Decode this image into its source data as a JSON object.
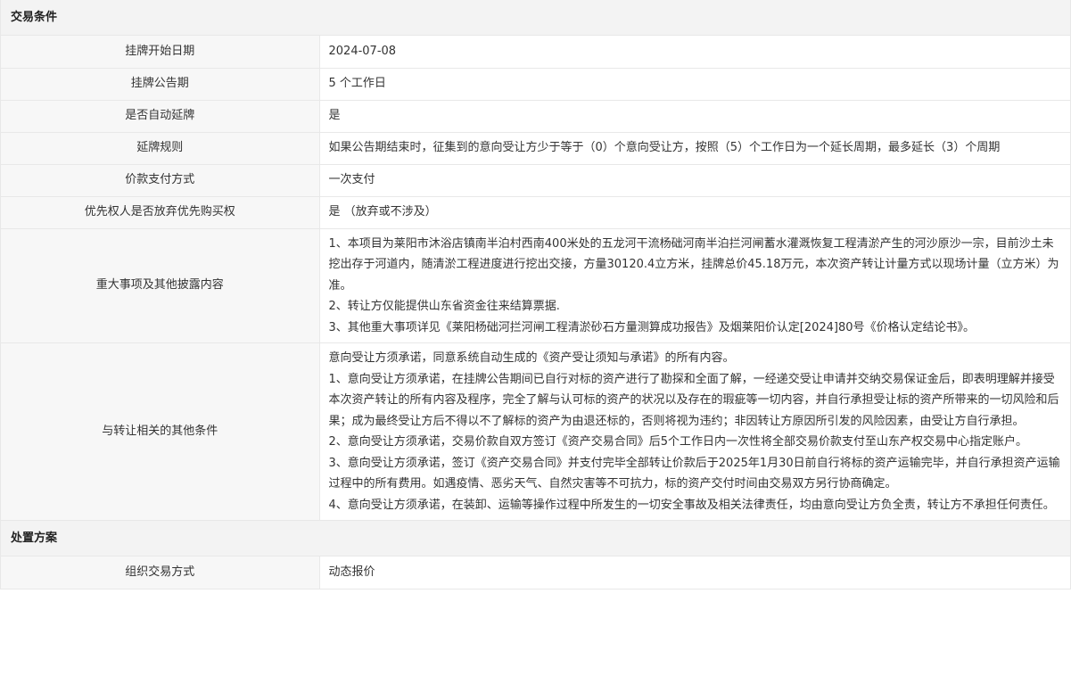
{
  "sections": [
    {
      "title": "交易条件",
      "rows": [
        {
          "label": "挂牌开始日期",
          "value": [
            "2024-07-08"
          ]
        },
        {
          "label": "挂牌公告期",
          "value": [
            "5 个工作日"
          ]
        },
        {
          "label": "是否自动延牌",
          "value": [
            "是"
          ]
        },
        {
          "label": "延牌规则",
          "value": [
            "如果公告期结束时，征集到的意向受让方少于等于（0）个意向受让方，按照（5）个工作日为一个延长周期，最多延长（3）个周期"
          ]
        },
        {
          "label": "价款支付方式",
          "value": [
            "一次支付"
          ]
        },
        {
          "label": "优先权人是否放弃优先购买权",
          "value": [
            "是 （放弃或不涉及）"
          ]
        },
        {
          "label": "重大事项及其他披露内容",
          "value": [
            "1、本项目为莱阳市沐浴店镇南半泊村西南400米处的五龙河干流杨础河南半泊拦河闸蓄水灌溉恢复工程清淤产生的河沙原沙一宗，目前沙土未挖出存于河道内，随清淤工程进度进行挖出交接，方量30120.4立方米，挂牌总价45.18万元，本次资产转让计量方式以现场计量（立方米）为准。",
            "2、转让方仅能提供山东省资金往来结算票据.",
            "3、其他重大事项详见《莱阳杨础河拦河闸工程清淤砂石方量测算成功报告》及烟莱阳价认定[2024]80号《价格认定结论书》。"
          ]
        },
        {
          "label": "与转让相关的其他条件",
          "value": [
            "意向受让方须承诺，同意系统自动生成的《资产受让须知与承诺》的所有内容。",
            "1、意向受让方须承诺，在挂牌公告期间已自行对标的资产进行了勘探和全面了解，一经递交受让申请并交纳交易保证金后，即表明理解并接受本次资产转让的所有内容及程序，完全了解与认可标的资产的状况以及存在的瑕疵等一切内容，并自行承担受让标的资产所带来的一切风险和后果；成为最终受让方后不得以不了解标的资产为由退还标的，否则将视为违约；非因转让方原因所引发的风险因素，由受让方自行承担。",
            "2、意向受让方须承诺，交易价款自双方签订《资产交易合同》后5个工作日内一次性将全部交易价款支付至山东产权交易中心指定账户。",
            "3、意向受让方须承诺，签订《资产交易合同》并支付完毕全部转让价款后于2025年1月30日前自行将标的资产运输完毕，并自行承担资产运输过程中的所有费用。如遇疫情、恶劣天气、自然灾害等不可抗力，标的资产交付时间由交易双方另行协商确定。",
            "4、意向受让方须承诺，在装卸、运输等操作过程中所发生的一切安全事故及相关法律责任，均由意向受让方负全责，转让方不承担任何责任。"
          ]
        }
      ]
    },
    {
      "title": "处置方案",
      "rows": [
        {
          "label": "组织交易方式",
          "value": [
            "动态报价"
          ]
        }
      ]
    }
  ]
}
